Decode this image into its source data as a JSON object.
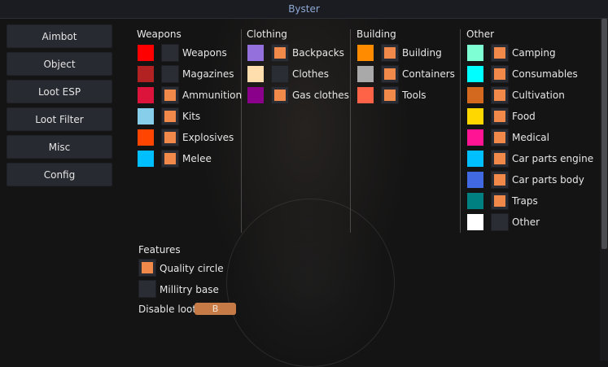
{
  "window": {
    "title": "Byster"
  },
  "sidebar": {
    "items": [
      {
        "label": "Aimbot"
      },
      {
        "label": "Object"
      },
      {
        "label": "Loot ESP"
      },
      {
        "label": "Loot Filter"
      },
      {
        "label": "Misc"
      },
      {
        "label": "Config"
      }
    ]
  },
  "weapons": {
    "title": "Weapons",
    "items": [
      {
        "label": "Weapons",
        "color": "#ff0000",
        "enabled": false
      },
      {
        "label": "Magazines",
        "color": "#b22222",
        "enabled": false
      },
      {
        "label": "Ammunition",
        "color": "#dc143c",
        "enabled": true
      },
      {
        "label": "Kits",
        "color": "#87ceeb",
        "enabled": true
      },
      {
        "label": "Explosives",
        "color": "#ff4500",
        "enabled": true
      },
      {
        "label": "Melee",
        "color": "#00bfff",
        "enabled": true
      }
    ]
  },
  "clothing": {
    "title": "Clothing",
    "items": [
      {
        "label": "Backpacks",
        "color": "#9370db",
        "enabled": true
      },
      {
        "label": "Clothes",
        "color": "#ffdead",
        "enabled": false
      },
      {
        "label": "Gas clothes",
        "color": "#8b008b",
        "enabled": true
      }
    ]
  },
  "building": {
    "title": "Building",
    "items": [
      {
        "label": "Building",
        "color": "#ff8c00",
        "enabled": true
      },
      {
        "label": "Containers",
        "color": "#a9a9a9",
        "enabled": true
      },
      {
        "label": "Tools",
        "color": "#ff6347",
        "enabled": true
      }
    ]
  },
  "other": {
    "title": "Other",
    "items": [
      {
        "label": "Camping",
        "color": "#7fffd4",
        "enabled": true
      },
      {
        "label": "Consumables",
        "color": "#00ffff",
        "enabled": true
      },
      {
        "label": "Cultivation",
        "color": "#d2691e",
        "enabled": true
      },
      {
        "label": "Food",
        "color": "#ffd700",
        "enabled": true
      },
      {
        "label": "Medical",
        "color": "#ff1493",
        "enabled": true
      },
      {
        "label": "Car parts engine",
        "color": "#00bfff",
        "enabled": true
      },
      {
        "label": "Car parts body",
        "color": "#4169e1",
        "enabled": true
      },
      {
        "label": "Traps",
        "color": "#008080",
        "enabled": true
      },
      {
        "label": "Other",
        "color": "#ffffff",
        "enabled": false
      }
    ]
  },
  "features": {
    "title": "Features",
    "items": [
      {
        "label": "Quality circle",
        "enabled": true
      },
      {
        "label": "Millitry base",
        "enabled": false
      }
    ],
    "disable_loot_label": "Disable loot:",
    "disable_loot_key": "B"
  }
}
